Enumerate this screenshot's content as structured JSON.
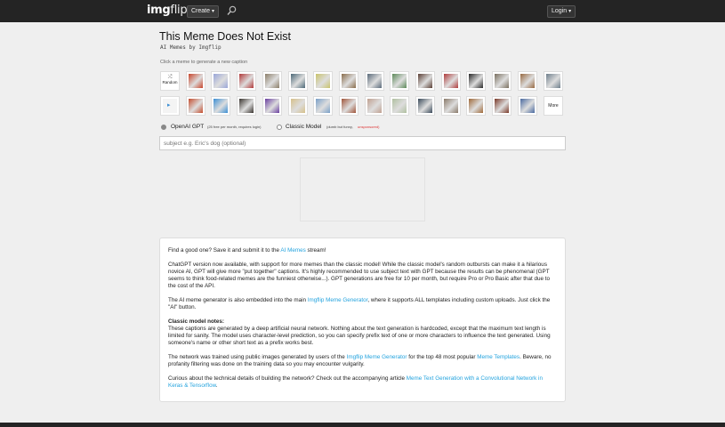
{
  "header": {
    "logo_main": "img",
    "logo_flip": "flip",
    "create_label": "Create",
    "login_label": "Login",
    "search_icon": "search-icon"
  },
  "page": {
    "title": "This Meme Does Not Exist",
    "subtitle": "AI Memes by Imgflip",
    "hint": "Click a meme to generate a new caption"
  },
  "thumbs": {
    "random_label": "Random",
    "more_label": "More",
    "row1_colors": [
      "#c8452b",
      "#9aa6d8",
      "#b23a3a",
      "#8c7f6a",
      "#4d6978",
      "#c9c36c",
      "#8a6d4c",
      "#5a6a7a",
      "#5d8a5a",
      "#5b3f35",
      "#b03c3c",
      "#2a2a2a",
      "#7a7060",
      "#986a42",
      "#6f7f8c"
    ],
    "row2_colors": [
      "#c44d2e",
      "#3c8fd4",
      "#3a3530",
      "#6a3fa0",
      "#d6c08a",
      "#7aa0c8",
      "#a0553a",
      "#c0a090",
      "#b0c0a0",
      "#3a4a5a",
      "#8a7a6a",
      "#a06a3a",
      "#7a3a2a",
      "#4a6aa0"
    ]
  },
  "model": {
    "openai_label": "OpenAI GPT",
    "openai_note": "(25 free per month, requires login)",
    "classic_label": "Classic Model",
    "classic_note": "(dumb but funny,",
    "classic_sponsored": "unsponsored)"
  },
  "subject_input": {
    "placeholder": "subject e.g. Eric's dog (optional)"
  },
  "info": {
    "p1_pre": "Find a good one? Save it and submit it to the ",
    "p1_link": "AI Memes",
    "p1_post": " stream!",
    "p2": "ChatGPT version now available, with support for more memes than the classic model! While the classic model's random outbursts can make it a hilarious novice AI, GPT will give more \"put together\" captions. It's highly recommended to use subject text with GPT because the results can be phenomenal (GPT seems to think food-related memes are the funniest otherwise...). GPT generations are free for 10 per month, but require Pro or Pro Basic after that due to the cost of the API.",
    "p3_pre": "The AI meme generator is also embedded into the main ",
    "p3_link": "Imgflip Meme Generator",
    "p3_post": ", where it supports ALL templates including custom uploads. Just click the \"AI\" button.",
    "p4_heading": "Classic model notes:",
    "p4": "These captions are generated by a deep artificial neural network. Nothing about the text generation is hardcoded, except that the maximum text length is limited for sanity. The model uses character-level prediction, so you can specify prefix text of one or more characters to influence the text generated. Using someone's name or other short text as a prefix works best.",
    "p5_pre": "The network was trained using public images generated by users of the ",
    "p5_link1": "Imgflip Meme Generator",
    "p5_mid": " for the top 48 most popular ",
    "p5_link2": "Meme Templates",
    "p5_post": ". Beware, no profanity filtering was done on the training data so you may encounter vulgarity.",
    "p6_pre": "Curious about the technical details of building the network? Check out the accompanying article ",
    "p6_link": "Meme Text Generation with a Convolutional Network in Keras & Tensorflow",
    "p6_post": "."
  }
}
